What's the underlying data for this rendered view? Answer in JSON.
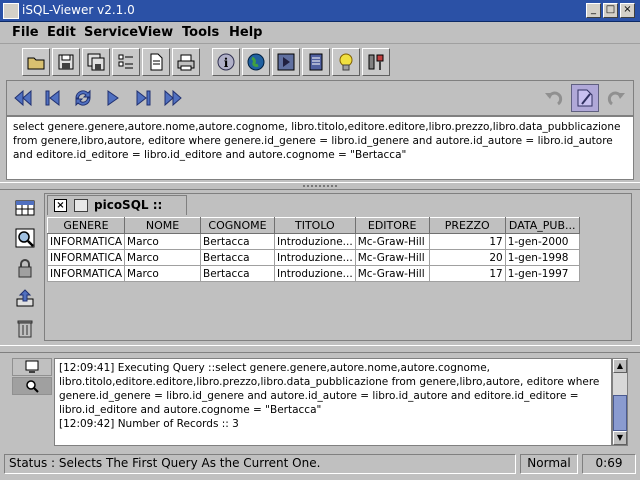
{
  "window": {
    "title": "iSQL-Viewer v2.1.0"
  },
  "menu": [
    "File",
    "Edit",
    "Service",
    "View",
    "Tools",
    "Help"
  ],
  "query_text": "select genere.genere,autore.nome,autore.cognome, libro.titolo,editore.editore,libro.prezzo,libro.data_pubblicazione from genere,libro,autore, editore where genere.id_genere = libro.id_genere and autore.id_autore = libro.id_autore and editore.id_editore = libro.id_editore and autore.cognome = \"Bertacca\"",
  "result_tab": {
    "label": "picoSQL ::"
  },
  "table": {
    "columns": [
      "GENERE",
      "NOME",
      "COGNOME",
      "TITOLO",
      "EDITORE",
      "PREZZO",
      "DATA_PUB..."
    ],
    "rows": [
      [
        "INFORMATICA",
        "Marco",
        "Bertacca",
        "Introduzione...",
        "Mc-Graw-Hill",
        "17",
        "1-gen-2000"
      ],
      [
        "INFORMATICA",
        "Marco",
        "Bertacca",
        "Introduzione...",
        "Mc-Graw-Hill",
        "20",
        "1-gen-1998"
      ],
      [
        "INFORMATICA",
        "Marco",
        "Bertacca",
        "Introduzione...",
        "Mc-Graw-Hill",
        "17",
        "1-gen-1997"
      ]
    ]
  },
  "log": [
    "[12:09:41] Executing Query ::select genere.genere,autore.nome,autore.cognome, libro.titolo,editore.editore,libro.prezzo,libro.data_pubblicazione from genere,libro,autore, editore where genere.id_genere = libro.id_genere and autore.id_autore = libro.id_autore and editore.id_editore = libro.id_editore and autore.cognome = \"Bertacca\"",
    "[12:09:42] Number of Records :: 3"
  ],
  "status": {
    "message": "Status : Selects The First Query As the Current One.",
    "mode": "Normal",
    "position": "0:69"
  }
}
